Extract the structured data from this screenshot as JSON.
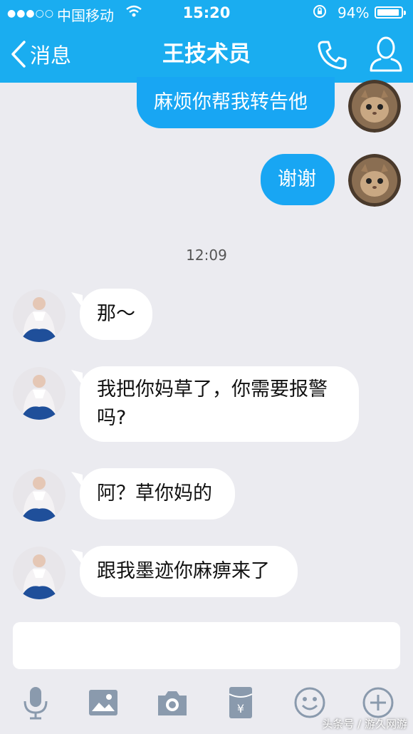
{
  "status_bar": {
    "carrier": "中国移动",
    "time": "15:20",
    "battery": "94%"
  },
  "nav": {
    "back_label": "消息",
    "title": "王技术员"
  },
  "messages": {
    "m1": "麻烦你帮我转告他",
    "m2": "谢谢",
    "timestamp": "12:09",
    "m3": "那～",
    "m4_line1": "我把你妈草了，你需要报警",
    "m4_line2": "吗?",
    "m5": "阿？草你妈的",
    "m6": "跟我墨迹你麻痹来了"
  },
  "input": {
    "placeholder": ""
  },
  "watermark": "头条号 / 游久网游",
  "colors": {
    "header": "#1aadf0",
    "sent_bubble": "#18a6f3",
    "received_bubble": "#ffffff",
    "background": "#ebebf0"
  }
}
